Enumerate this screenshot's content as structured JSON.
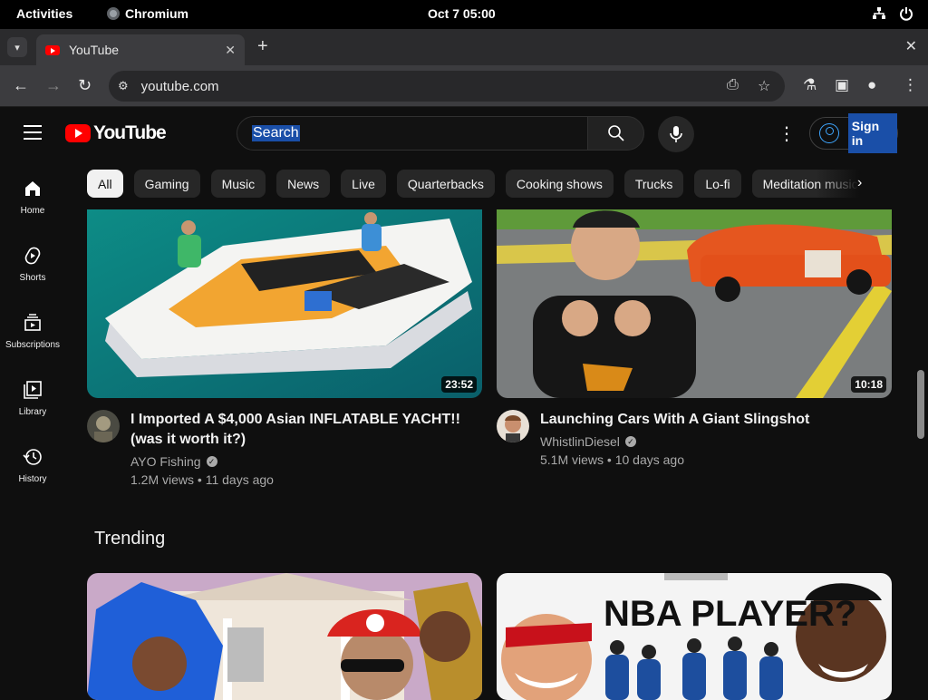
{
  "system": {
    "activities": "Activities",
    "app_name": "Chromium",
    "clock": "Oct 7  05:00"
  },
  "browser": {
    "tab_title": "YouTube",
    "url": "youtube.com"
  },
  "youtube": {
    "logo_text": "YouTube",
    "search_placeholder": "Search",
    "sign_in": "Sign in",
    "chips": [
      "All",
      "Gaming",
      "Music",
      "News",
      "Live",
      "Quarterbacks",
      "Cooking shows",
      "Trucks",
      "Lo-fi",
      "Meditation music"
    ],
    "nav": [
      {
        "label": "Home",
        "icon": "home-icon"
      },
      {
        "label": "Shorts",
        "icon": "shorts-icon"
      },
      {
        "label": "Subscriptions",
        "icon": "subscriptions-icon"
      },
      {
        "label": "Library",
        "icon": "library-icon"
      },
      {
        "label": "History",
        "icon": "history-icon"
      }
    ],
    "videos": [
      {
        "title": "I Imported A $4,000 Asian INFLATABLE YACHT!! (was it worth it?)",
        "channel": "AYO Fishing",
        "meta": "1.2M views • 11 days ago",
        "duration": "23:52"
      },
      {
        "title": "Launching Cars With A Giant Slingshot",
        "channel": "WhistlinDiesel",
        "meta": "5.1M views • 10 days ago",
        "duration": "10:18"
      }
    ],
    "section_title": "Trending",
    "trending_thumb_text": "NBA PLAYER?"
  },
  "colors": {
    "background": "#0f0f0f",
    "chip_bg": "#272727",
    "accent_red": "#ff0000",
    "link_blue": "#3ea6ff"
  }
}
